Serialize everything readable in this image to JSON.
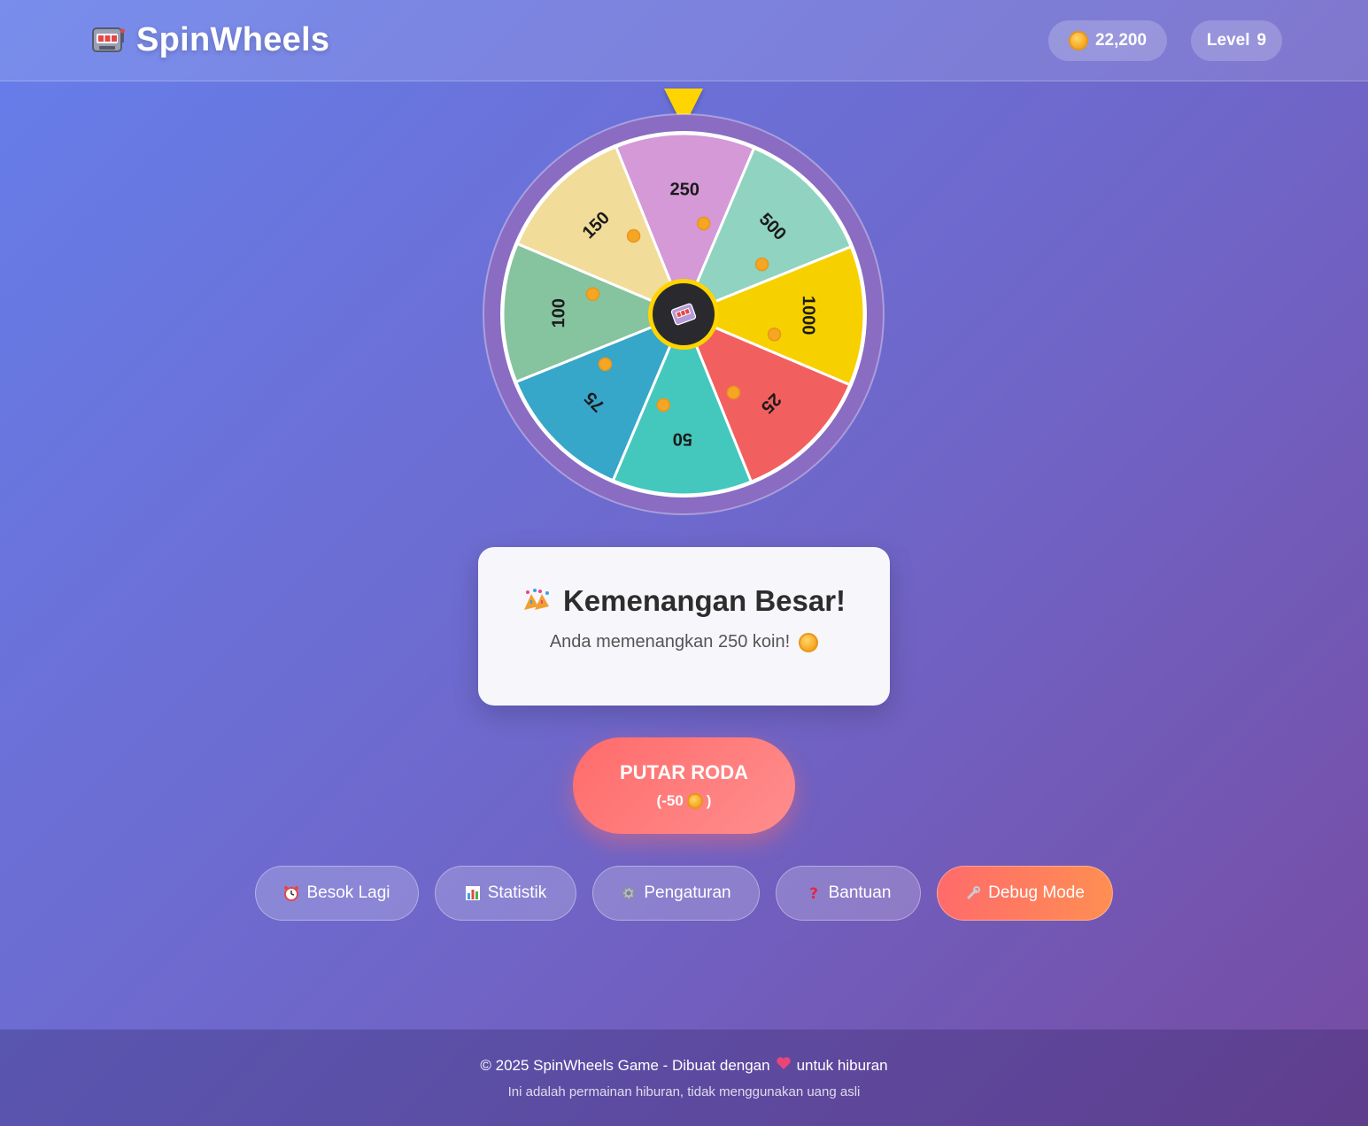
{
  "app": {
    "title": "SpinWheels",
    "logo_icon": "slot-machine-icon"
  },
  "header": {
    "coins": "22,200",
    "coin_icon": "coin-icon",
    "level_label": "Level",
    "level_value": "9"
  },
  "wheel": {
    "segments": [
      {
        "label": "250",
        "color": "#d499d6"
      },
      {
        "label": "500",
        "color": "#8fd3c0"
      },
      {
        "label": "1000",
        "color": "#f7d000"
      },
      {
        "label": "25",
        "color": "#f25f5f"
      },
      {
        "label": "50",
        "color": "#44c8bd"
      },
      {
        "label": "75",
        "color": "#36a6c9"
      },
      {
        "label": "100",
        "color": "#86c39f"
      },
      {
        "label": "150",
        "color": "#f2dc9a"
      }
    ],
    "center_icon": "slot-machine-icon",
    "pointer_color": "#ffd400",
    "rim_color": "#8a6cc2"
  },
  "result": {
    "icon": "party-popper-icon",
    "title": "Kemenangan Besar!",
    "message": "Anda memenangkan 250 koin!"
  },
  "spin_button": {
    "label": "PUTAR RODA",
    "cost_prefix": "(-50",
    "cost_suffix": ")"
  },
  "actions": [
    {
      "label": "Besok Lagi",
      "icon": "alarm-clock-icon"
    },
    {
      "label": "Statistik",
      "icon": "bar-chart-icon"
    },
    {
      "label": "Pengaturan",
      "icon": "gear-icon"
    },
    {
      "label": "Bantuan",
      "icon": "question-mark-icon"
    },
    {
      "label": "Debug Mode",
      "icon": "wrench-icon"
    }
  ],
  "footer": {
    "line1_prefix": "© 2025 SpinWheels Game - Dibuat dengan",
    "line1_suffix": "untuk hiburan",
    "line2": "Ini adalah permainan hiburan, tidak menggunakan uang asli"
  },
  "colors": {
    "accent_red": "#ff6b6b",
    "accent_orange": "#ff8e53",
    "coin_gold": "#f5a623"
  }
}
